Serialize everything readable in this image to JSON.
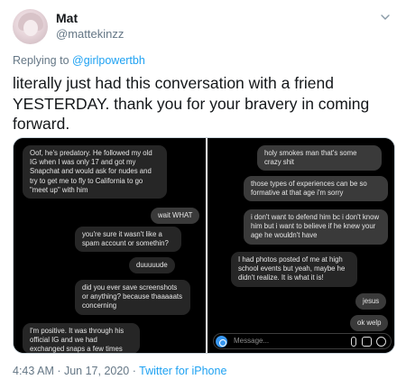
{
  "tweet": {
    "display_name": "Mat",
    "handle": "@mattekinzz",
    "replying_prefix": "Replying to",
    "replying_to": "@girlpowertbh",
    "text": "literally just had this conversation with a friend YESTERDAY. thank you for your bravery in coming forward.",
    "timestamp": "4:43 AM · Jun 17, 2020 · ",
    "source": "Twitter for iPhone"
  },
  "screenshot_left": {
    "messages": [
      {
        "from": "friend",
        "text": "Oof, he's predatory. He followed my old IG when I was only 17 and got my Snapchat and would ask for nudes and try to get me to fly to California to go \"meet up\" with him"
      },
      {
        "from": "me",
        "text": "wait WHAT"
      },
      {
        "from": "me",
        "text": "you're sure it wasn't like a spam account or somethin?"
      },
      {
        "from": "friend",
        "text": "duuuuude"
      },
      {
        "from": "me",
        "text": "did you ever save screenshots or anything? because thaaaaats concerning"
      },
      {
        "from": "friend",
        "text": "I'm positive. It was through his official IG and we had exchanged snaps a few times through his"
      }
    ]
  },
  "screenshot_right": {
    "messages": [
      {
        "from": "me",
        "text": "holy smokes man that's some crazy shit"
      },
      {
        "from": "me",
        "text": "those types of experiences can be so formative at that age i'm sorry"
      },
      {
        "from": "me",
        "text": "i don't want to defend him bc i don't know him but i want to believe if he knew your age he wouldn't have"
      },
      {
        "from": "friend",
        "text": "I had photos posted of me at high school events but yeah, maybe he didn't realize. It is what it is!"
      },
      {
        "from": "me",
        "text": "jesus"
      },
      {
        "from": "me",
        "text": "ok welp"
      }
    ],
    "composer_placeholder": "Message..."
  },
  "icons": {
    "more": "chevron-down-icon",
    "camera": "camera-icon",
    "mic": "microphone-icon",
    "photo": "photo-icon",
    "sticker": "sticker-icon"
  },
  "colors": {
    "link": "#1da1f2",
    "muted": "#657786",
    "text": "#14171a",
    "dm_background": "#000000",
    "bubble": "#262626",
    "camera": "#3897f0"
  }
}
